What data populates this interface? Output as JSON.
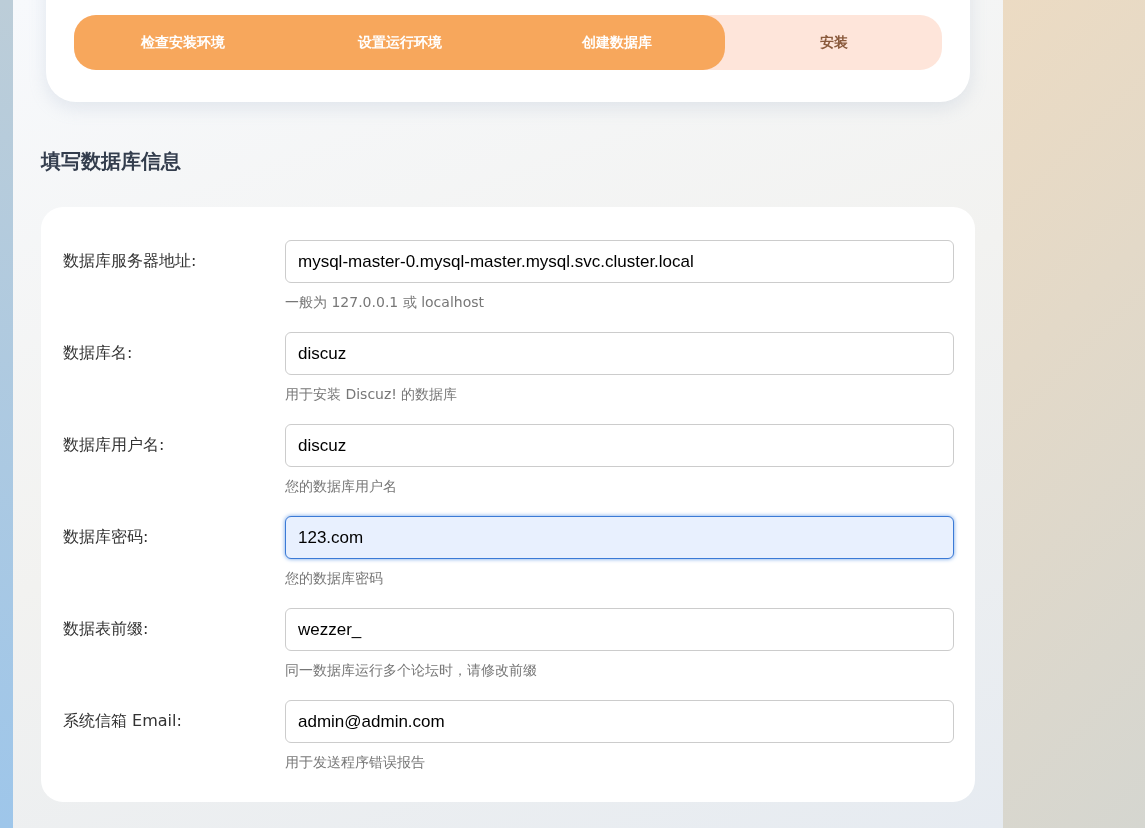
{
  "steps": [
    {
      "label": "检查安装环境",
      "done": true
    },
    {
      "label": "设置运行环境",
      "done": true
    },
    {
      "label": "创建数据库",
      "done": true
    },
    {
      "label": "安装",
      "done": false
    }
  ],
  "section_title": "填写数据库信息",
  "fields": [
    {
      "label": "数据库服务器地址:",
      "value": "mysql-master-0.mysql-master.mysql.svc.cluster.local",
      "hint": "一般为 127.0.0.1 或 localhost",
      "focused": false
    },
    {
      "label": "数据库名:",
      "value": "discuz",
      "hint": "用于安装 Discuz! 的数据库",
      "focused": false
    },
    {
      "label": "数据库用户名:",
      "value": "discuz",
      "hint": "您的数据库用户名",
      "focused": false
    },
    {
      "label": "数据库密码:",
      "value": "123.com",
      "hint": "您的数据库密码",
      "focused": true
    },
    {
      "label": "数据表前缀:",
      "value": "wezzer_",
      "hint": "同一数据库运行多个论坛时，请修改前缀",
      "focused": false
    },
    {
      "label": "系统信箱 Email:",
      "value": "admin@admin.com",
      "hint": "用于发送程序错误报告",
      "focused": false
    }
  ]
}
